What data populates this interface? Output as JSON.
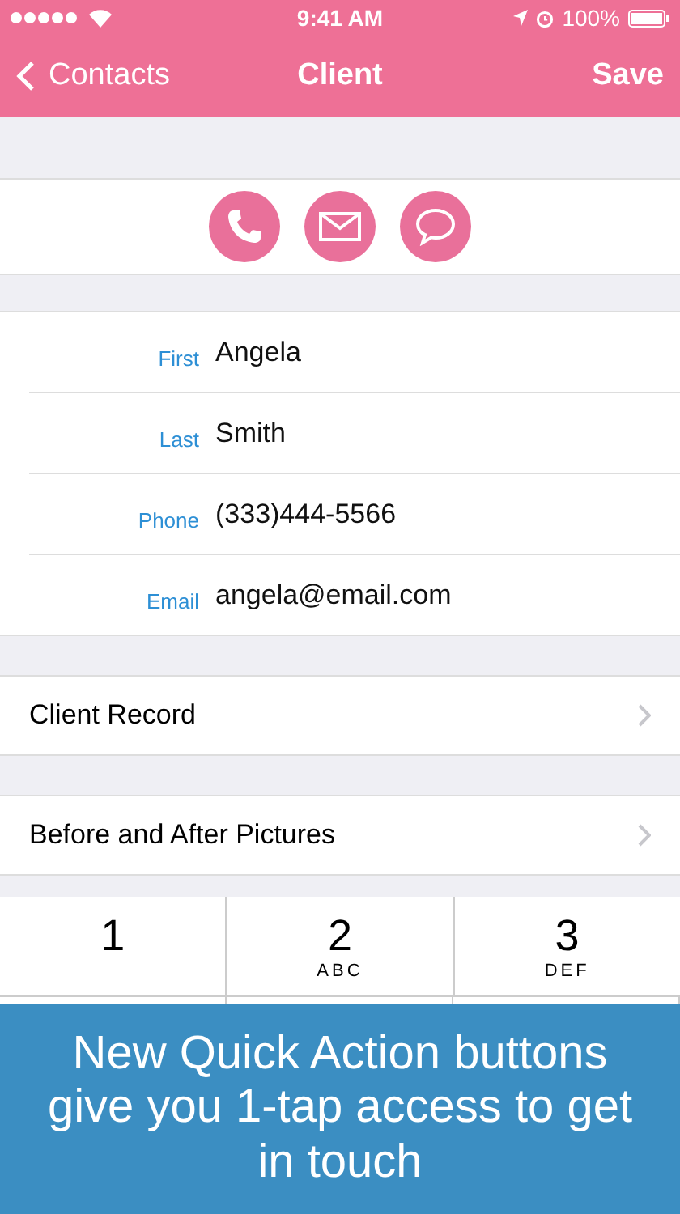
{
  "status_bar": {
    "time": "9:41 AM",
    "battery": "100%"
  },
  "nav": {
    "back": "Contacts",
    "title": "Client",
    "action": "Save"
  },
  "quick_actions": [
    {
      "kind": "phone"
    },
    {
      "kind": "email"
    },
    {
      "kind": "message"
    }
  ],
  "fields": [
    {
      "label": "First",
      "value": "Angela"
    },
    {
      "label": "Last",
      "value": "Smith"
    },
    {
      "label": "Phone",
      "value": "(333)444-5566"
    },
    {
      "label": "Email",
      "value": "angela@email.com"
    }
  ],
  "links": [
    "Client Record",
    "Before and After Pictures"
  ],
  "keypad": [
    {
      "digit": "1"
    },
    {
      "digit": "2",
      "letters": "ABC"
    },
    {
      "digit": "3",
      "letters": "DEF"
    }
  ],
  "banner": "New Quick Action buttons give you 1-tap access to get in touch"
}
